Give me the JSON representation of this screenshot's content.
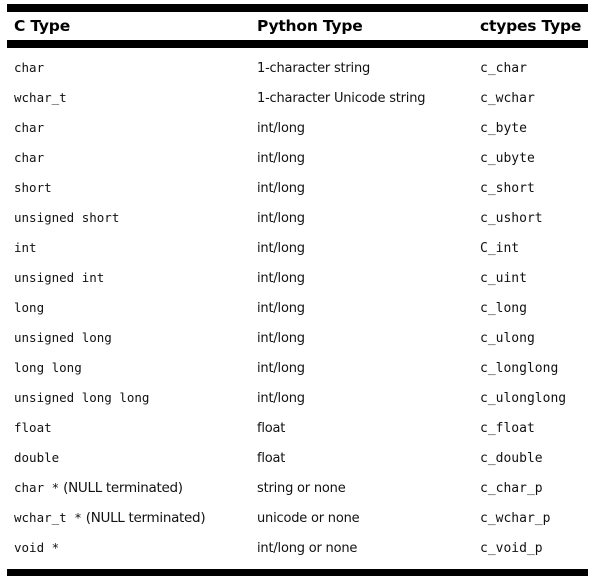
{
  "table": {
    "headers": [
      "C Type",
      "Python Type",
      "ctypes Type"
    ],
    "rows": [
      {
        "c_type": "char",
        "c_note": "",
        "python_type": "1-character string",
        "ctypes_type": "c_char"
      },
      {
        "c_type": "wchar_t",
        "c_note": "",
        "python_type": "1-character Unicode string",
        "ctypes_type": "c_wchar"
      },
      {
        "c_type": "char",
        "c_note": "",
        "python_type": "int/long",
        "ctypes_type": "c_byte"
      },
      {
        "c_type": "char",
        "c_note": "",
        "python_type": "int/long",
        "ctypes_type": "c_ubyte"
      },
      {
        "c_type": "short",
        "c_note": "",
        "python_type": "int/long",
        "ctypes_type": "c_short"
      },
      {
        "c_type": "unsigned short",
        "c_note": "",
        "python_type": "int/long",
        "ctypes_type": "c_ushort"
      },
      {
        "c_type": "int",
        "c_note": "",
        "python_type": "int/long",
        "ctypes_type": "C_int"
      },
      {
        "c_type": "unsigned int",
        "c_note": "",
        "python_type": "int/long",
        "ctypes_type": "c_uint"
      },
      {
        "c_type": "long",
        "c_note": "",
        "python_type": "int/long",
        "ctypes_type": "c_long"
      },
      {
        "c_type": "unsigned long",
        "c_note": "",
        "python_type": "int/long",
        "ctypes_type": "c_ulong"
      },
      {
        "c_type": "long long",
        "c_note": "",
        "python_type": "int/long",
        "ctypes_type": "c_longlong"
      },
      {
        "c_type": "unsigned long long",
        "c_note": "",
        "python_type": "int/long",
        "ctypes_type": "c_ulonglong"
      },
      {
        "c_type": "float",
        "c_note": "",
        "python_type": "float",
        "ctypes_type": "c_float"
      },
      {
        "c_type": "double",
        "c_note": "",
        "python_type": "float",
        "ctypes_type": "c_double"
      },
      {
        "c_type": "char *",
        "c_note": "(NULL terminated)",
        "python_type": "string or none",
        "ctypes_type": "c_char_p"
      },
      {
        "c_type": "wchar_t *",
        "c_note": "(NULL terminated)",
        "python_type": "unicode or none",
        "ctypes_type": "c_wchar_p"
      },
      {
        "c_type": "void *",
        "c_note": "",
        "python_type": "int/long or none",
        "ctypes_type": "c_void_p"
      }
    ]
  },
  "colors": {
    "rule": "#000000",
    "text": "#111111",
    "background": "#ffffff"
  }
}
